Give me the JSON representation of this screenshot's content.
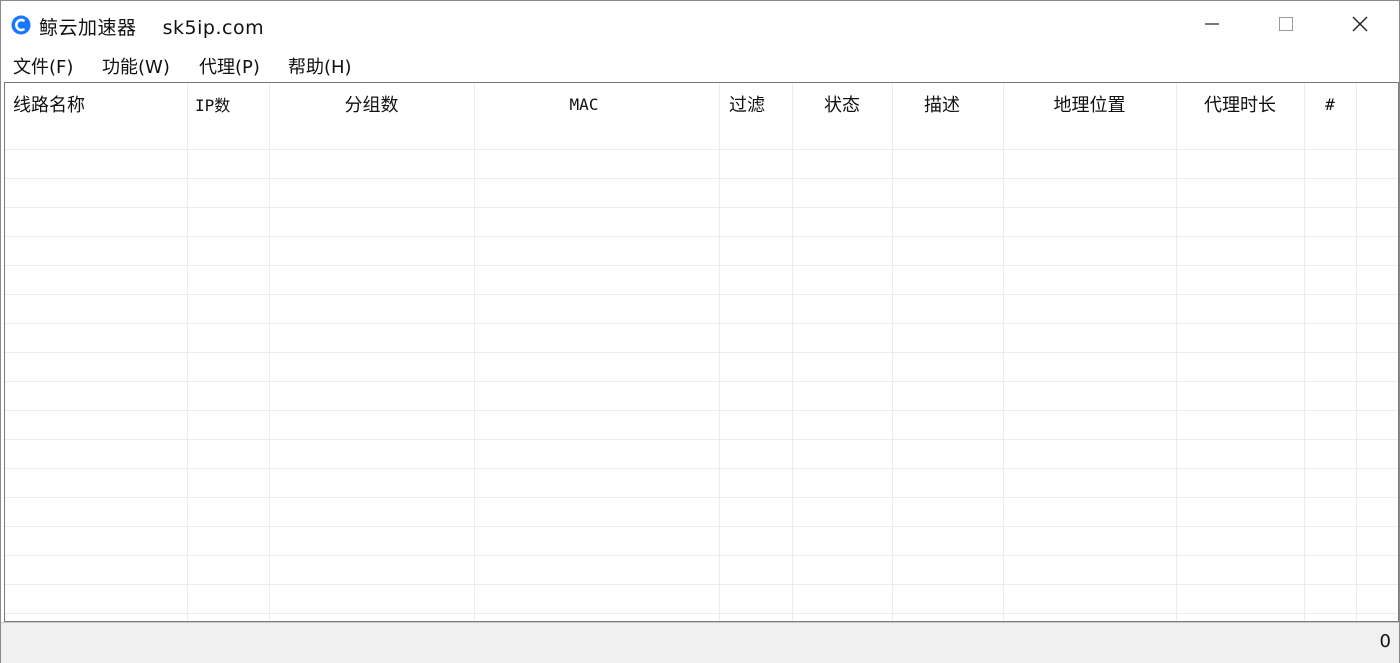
{
  "window": {
    "title": "鲸云加速器    sk5ip.com",
    "controls": [
      "minimize-icon",
      "maximize-icon",
      "close-icon"
    ]
  },
  "menu": {
    "items": [
      {
        "label": "文件(F)"
      },
      {
        "label": "功能(W)"
      },
      {
        "label": "代理(P)"
      },
      {
        "label": "帮助(H)"
      }
    ]
  },
  "table": {
    "columns": [
      {
        "label": "线路名称"
      },
      {
        "label": "IP数"
      },
      {
        "label": "分组数"
      },
      {
        "label": "MAC"
      },
      {
        "label": "过滤"
      },
      {
        "label": "状态"
      },
      {
        "label": "描述"
      },
      {
        "label": "地理位置"
      },
      {
        "label": "代理时长"
      },
      {
        "label": "#"
      }
    ],
    "rows": []
  },
  "status": {
    "count": "0"
  },
  "colors": {
    "accent": "#1677ff",
    "grid": "#ececec",
    "status_bg": "#f0f0f0"
  }
}
